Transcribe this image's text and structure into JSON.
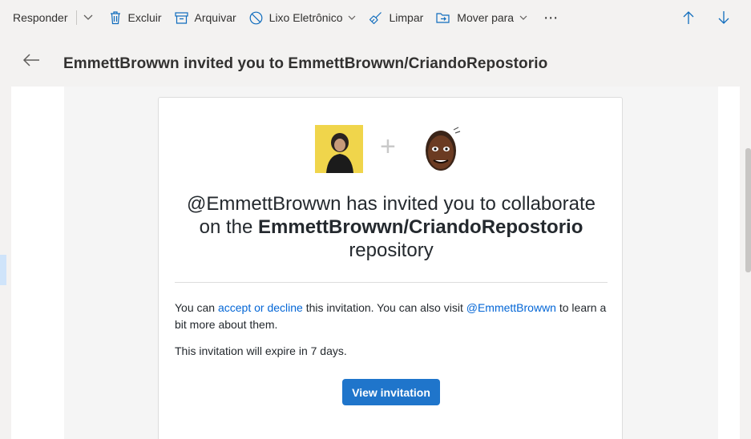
{
  "toolbar": {
    "reply_label": "Responder",
    "delete_label": "Excluir",
    "archive_label": "Arquivar",
    "junk_label": "Lixo Eletrônico",
    "sweep_label": "Limpar",
    "move_label": "Mover para",
    "more_label": "⋯"
  },
  "header": {
    "subject": "EmmettBrowwn invited you to EmmettBrowwn/CriandoRepostorio"
  },
  "email": {
    "plus_sign": "+",
    "headline_prefix": "@EmmettBrowwn has invited you to collaborate on the",
    "headline_repo": "EmmettBrowwn/CriandoRepostorio",
    "headline_suffix": "repository",
    "para1_a": "You can ",
    "para1_link1": "accept or decline",
    "para1_b": " this invitation. You can also visit ",
    "para1_link2": "@EmmettBrowwn",
    "para1_c": " to learn a bit more about them.",
    "para2": "This invitation will expire in 7 days.",
    "button_label": "View invitation"
  },
  "colors": {
    "accent_link": "#0366d6",
    "button_bg": "#1f75cb"
  }
}
